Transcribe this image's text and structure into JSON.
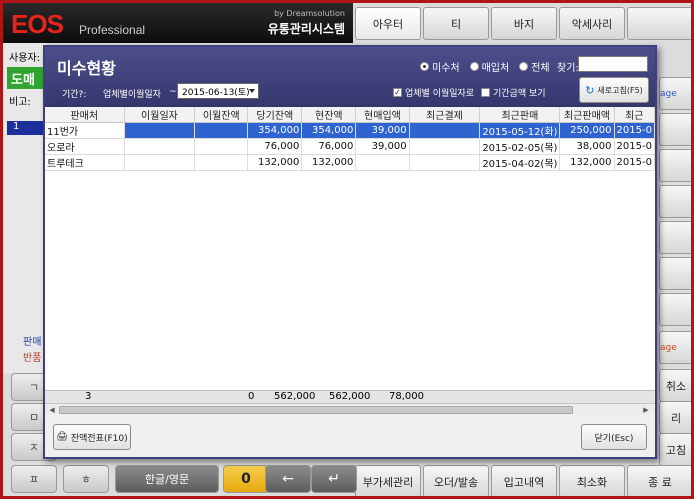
{
  "app": {
    "logo": "EOS",
    "logo_sub": "Professional",
    "brand_by": "by Dreamsolution",
    "brand_name": "유통관리시스템"
  },
  "left": {
    "user_label": "사용자:",
    "green_button": "도매",
    "note_label": "비고:",
    "row_number": "1",
    "side_text_1": "판매",
    "side_text_2": "반품"
  },
  "tiles": {
    "row1": [
      "아우터",
      "티",
      "바지",
      "악세사리",
      ""
    ],
    "page_text": "age",
    "page_text_2": "age",
    "cancel": "취소",
    "ri": "리",
    "refresh": "고침",
    "bottom": [
      "부가세관리",
      "오더/발송",
      "입고내역",
      "최소화",
      "종  료"
    ]
  },
  "keypad": {
    "keys": [
      "ㄱ",
      "ㅁ",
      "ㅈ",
      "ㅍ",
      "ㅎ"
    ],
    "lang": "한글/영문",
    "zero": "0",
    "back": "←",
    "enter": "↵"
  },
  "dialog": {
    "title": "미수현황",
    "radio_options": [
      {
        "label": "미수처",
        "checked": true
      },
      {
        "label": "매입처",
        "checked": false
      },
      {
        "label": "전체",
        "checked": false
      }
    ],
    "search_label": "찾기:",
    "search_value": "",
    "period_label": "기간?:",
    "period_type": "업체별이월일자",
    "period_dash": "~",
    "date_value": "2015-06-13(토)",
    "check_by_vendor": "업체별 이월일자로",
    "check_by_vendor_checked": "✓",
    "check_period_amount": "기간금액 보기",
    "refresh_button": "새로고침(F5)",
    "columns": [
      "판매처",
      "이월일자",
      "이월잔액",
      "당기잔액",
      "현잔액",
      "현매입액",
      "최근결제",
      "최근판매",
      "최근판매액",
      "최근"
    ],
    "rows": [
      [
        "11번가",
        "",
        "",
        "354,000",
        "354,000",
        "39,000",
        "",
        "2015-05-12(화)",
        "250,000",
        "2015-0"
      ],
      [
        "오로라",
        "",
        "",
        "76,000",
        "76,000",
        "39,000",
        "",
        "2015-02-05(목)",
        "38,000",
        "2015-0"
      ],
      [
        "트루테크",
        "",
        "",
        "132,000",
        "132,000",
        "",
        "",
        "2015-04-02(목)",
        "132,000",
        "2015-0"
      ]
    ],
    "totals": {
      "count": "3",
      "carry": "0",
      "current_period": "562,000",
      "current_balance": "562,000",
      "purchases": "78,000"
    },
    "print_button": "잔액전표(F10)",
    "close_button": "닫기(Esc)"
  }
}
